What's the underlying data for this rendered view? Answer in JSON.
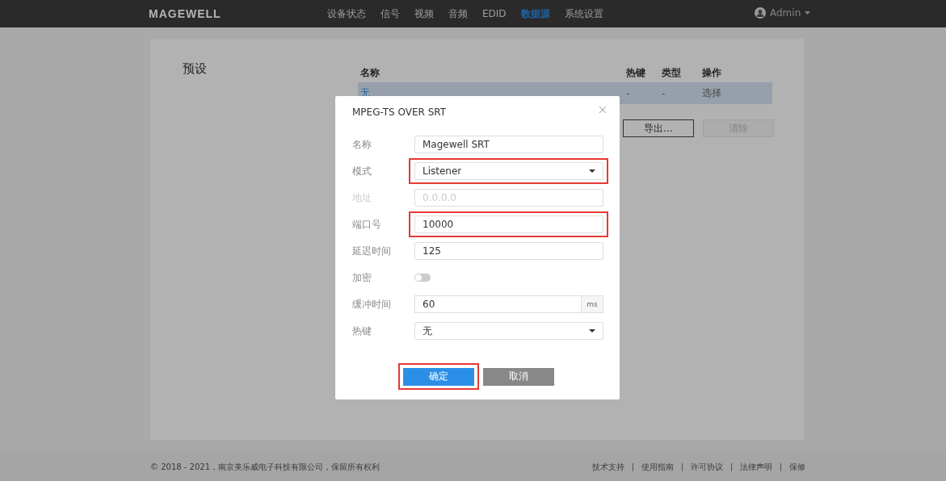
{
  "header": {
    "logo": "MAGEWELL",
    "nav": [
      {
        "label": "设备状态",
        "selected": false
      },
      {
        "label": "信号",
        "selected": false
      },
      {
        "label": "视频",
        "selected": false
      },
      {
        "label": "音频",
        "selected": false
      },
      {
        "label": "EDID",
        "selected": false
      },
      {
        "label": "数据源",
        "selected": true
      },
      {
        "label": "系统设置",
        "selected": false
      }
    ],
    "user": "Admin"
  },
  "section_title": "预设",
  "table": {
    "columns": [
      "名称",
      "热键",
      "类型",
      "操作"
    ],
    "rows": [
      {
        "name": "无",
        "hotkey": "-",
        "type": "-",
        "action": "选择",
        "selected": true
      }
    ]
  },
  "table_buttons": [
    {
      "label": "导出...",
      "disabled": false
    },
    {
      "label": "清除",
      "disabled": true
    }
  ],
  "dialog": {
    "title": "MPEG-TS OVER SRT",
    "fields": [
      {
        "kind": "text",
        "label": "名称",
        "value": "Magewell SRT",
        "disabled": false,
        "highlighted": false
      },
      {
        "kind": "select",
        "label": "模式",
        "value": "Listener",
        "disabled": false,
        "highlighted": true
      },
      {
        "kind": "text",
        "label": "地址",
        "placeholder": "0.0.0.0",
        "disabled": true,
        "highlighted": false
      },
      {
        "kind": "text",
        "label": "端口号",
        "value": "10000",
        "disabled": false,
        "highlighted": true
      },
      {
        "kind": "text",
        "label": "延迟时间",
        "value": "125",
        "disabled": false,
        "highlighted": false
      },
      {
        "kind": "toggle",
        "label": "加密",
        "on": false,
        "disabled": false,
        "highlighted": false
      },
      {
        "kind": "unit",
        "label": "缓冲时间",
        "value": "60",
        "unit": "ms",
        "disabled": false,
        "highlighted": false
      },
      {
        "kind": "select",
        "label": "热键",
        "value": "无",
        "disabled": false,
        "highlighted": false
      }
    ],
    "buttons": [
      {
        "kind": "primary",
        "label": "确定",
        "highlighted": true
      },
      {
        "kind": "secondary",
        "label": "取消",
        "highlighted": false
      }
    ]
  },
  "footer": {
    "copyright": "© 2018 - 2021，南京美乐威电子科技有限公司，保留所有权利",
    "links": [
      "技术支持",
      "使用指南",
      "许可协议",
      "法律声明",
      "保修"
    ]
  }
}
